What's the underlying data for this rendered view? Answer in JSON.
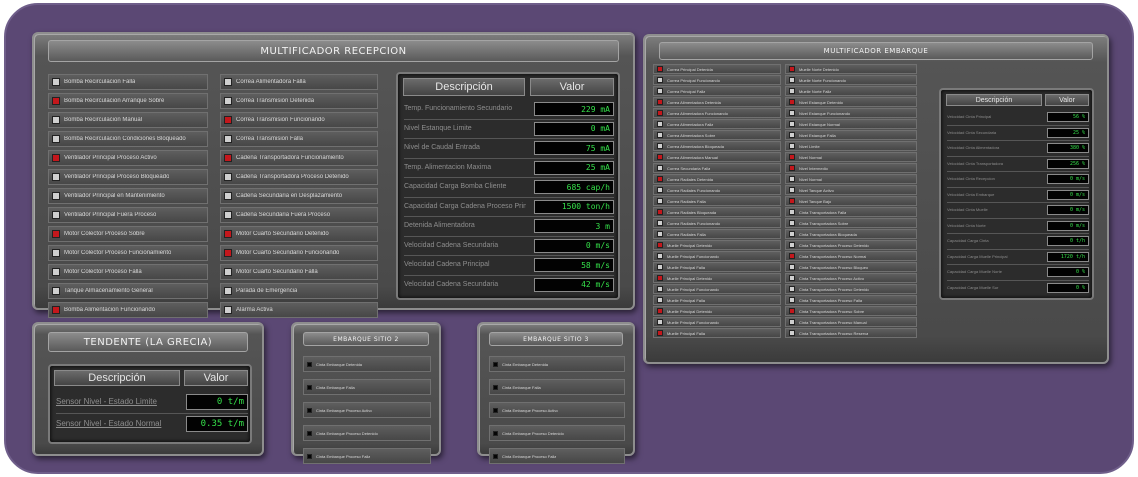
{
  "recepcion": {
    "title": "MULTIFICADOR RECEPCION",
    "col1": [
      {
        "label": "Bomba Recirculacion Falla",
        "color": "gray"
      },
      {
        "label": "Bomba Recirculacion Arranque Sobre",
        "color": "red"
      },
      {
        "label": "Bomba Recirculacion Manual",
        "color": "gray"
      },
      {
        "label": "Bomba Recirculacion Condiciones Bloqueado",
        "color": "gray"
      },
      {
        "label": "Ventilador Principal Proceso Activo",
        "color": "red"
      },
      {
        "label": "Ventilador Principal Proceso Bloqueado",
        "color": "gray"
      },
      {
        "label": "Ventilador Principal en Mantenimiento",
        "color": "gray"
      },
      {
        "label": "Ventilador Principal Fuera Proceso",
        "color": "gray"
      },
      {
        "label": "Motor Colector Proceso Sobre",
        "color": "red"
      },
      {
        "label": "Motor Colector Proceso Funcionamiento",
        "color": "gray"
      },
      {
        "label": "Motor Colector Proceso Falla",
        "color": "gray"
      },
      {
        "label": "Tanque Almacenamiento General",
        "color": "gray"
      },
      {
        "label": "Bomba Alimentacion Funcionando",
        "color": "red"
      }
    ],
    "col2": [
      {
        "label": "Correa Alimentadora Falla",
        "color": "gray"
      },
      {
        "label": "Correa Transmision Detenida",
        "color": "gray"
      },
      {
        "label": "Correa Transmision Funcionando",
        "color": "red"
      },
      {
        "label": "Correa Transmision Falla",
        "color": "gray"
      },
      {
        "label": "Cadena Transportadora Funcionamiento",
        "color": "red"
      },
      {
        "label": "Cadena Transportadora Proceso Detenido",
        "color": "gray"
      },
      {
        "label": "Cadena Secundaria en Desplazamiento",
        "color": "gray"
      },
      {
        "label": "Cadena Secundaria Fuera Proceso",
        "color": "gray"
      },
      {
        "label": "Motor Cuarto Secundario Detenido",
        "color": "red"
      },
      {
        "label": "Motor Cuarto Secundario Funcionando",
        "color": "red"
      },
      {
        "label": "Motor Cuarto Secundario Falla",
        "color": "gray"
      },
      {
        "label": "Parada de Emergencia",
        "color": "gray"
      },
      {
        "label": "Alarma Activa",
        "color": "gray"
      }
    ],
    "table": {
      "header_desc": "Descripción",
      "header_val": "Valor",
      "rows": [
        {
          "desc": "Temp. Funcionamiento Secundario",
          "value": "229  mA"
        },
        {
          "desc": "Nivel Estanque Limite",
          "value": "0  mA"
        },
        {
          "desc": "Nivel de Caudal Entrada",
          "value": "75  mA"
        },
        {
          "desc": "Temp. Alimentacion Maxima",
          "value": "25  mA"
        },
        {
          "desc": "Capacidad Carga Bomba Cliente",
          "value": "685 cap/h"
        },
        {
          "desc": "Capacidad Carga Cadena Proceso Principal",
          "value": "1500 ton/h"
        },
        {
          "desc": "Detenida Alimentadora",
          "value": "3  m"
        },
        {
          "desc": "Velocidad Cadena Secundaria",
          "value": "0  m/s"
        },
        {
          "desc": "Velocidad Cadena Principal",
          "value": "58  m/s"
        },
        {
          "desc": "Velocidad Cadena Secundaria",
          "value": "42  m/s"
        }
      ]
    }
  },
  "embarque": {
    "title": "MULTIFICADOR EMBARQUE",
    "col1": [
      {
        "label": "Correa Principal Detenida",
        "color": "red"
      },
      {
        "label": "Correa Principal Funcionando",
        "color": "gray"
      },
      {
        "label": "Correa Principal Falla",
        "color": "gray"
      },
      {
        "label": "Correa Alimentadora Detenida",
        "color": "red"
      },
      {
        "label": "Correa Alimentadora Funcionando",
        "color": "red"
      },
      {
        "label": "Correa Alimentadora Falla",
        "color": "gray"
      },
      {
        "label": "Correa Alimentadora Sobre",
        "color": "gray"
      },
      {
        "label": "Correa Alimentadora Bloqueada",
        "color": "gray"
      },
      {
        "label": "Correa Alimentadora Manual",
        "color": "red"
      },
      {
        "label": "Correa Secundaria Falla",
        "color": "gray"
      },
      {
        "label": "Correa Radiales Detenida",
        "color": "red"
      },
      {
        "label": "Correa Radiales Funcionando",
        "color": "gray"
      },
      {
        "label": "Correa Radiales Falla",
        "color": "gray"
      },
      {
        "label": "Correa Radiales Bloqueada",
        "color": "red"
      },
      {
        "label": "Correa Radiales Funcionando",
        "color": "gray"
      },
      {
        "label": "Correa Radiales Falla",
        "color": "gray"
      },
      {
        "label": "Muelle Principal Detenido",
        "color": "red"
      },
      {
        "label": "Muelle Principal Funcionando",
        "color": "gray"
      },
      {
        "label": "Muelle Principal Falla",
        "color": "gray"
      },
      {
        "label": "Muelle Principal Detenido",
        "color": "red"
      },
      {
        "label": "Muelle Principal Funcionando",
        "color": "gray"
      },
      {
        "label": "Muelle Principal Falla",
        "color": "gray"
      },
      {
        "label": "Muelle Principal Detenido",
        "color": "red"
      },
      {
        "label": "Muelle Principal Funcionando",
        "color": "gray"
      },
      {
        "label": "Muelle Principal Falla",
        "color": "red"
      }
    ],
    "col2": [
      {
        "label": "Muelle Norte Detenido",
        "color": "red"
      },
      {
        "label": "Muelle Norte Funcionando",
        "color": "gray"
      },
      {
        "label": "Muelle Norte Falla",
        "color": "gray"
      },
      {
        "label": "Nivel Estanque Detenido",
        "color": "red"
      },
      {
        "label": "Nivel Estanque Funcionando",
        "color": "gray"
      },
      {
        "label": "Nivel Estanque Normal",
        "color": "gray"
      },
      {
        "label": "Nivel Estanque Falla",
        "color": "gray"
      },
      {
        "label": "Nivel Limite",
        "color": "gray"
      },
      {
        "label": "Nivel Normal",
        "color": "red"
      },
      {
        "label": "Nivel Intermedio",
        "color": "red"
      },
      {
        "label": "Nivel Normal",
        "color": "gray"
      },
      {
        "label": "Nivel Tanque Activo",
        "color": "gray"
      },
      {
        "label": "Nivel Tanque Bajo",
        "color": "red"
      },
      {
        "label": "Cinta Transportadora Falla",
        "color": "gray"
      },
      {
        "label": "Cinta Transportadora Sobre",
        "color": "gray"
      },
      {
        "label": "Cinta Transportadora Bloqueada",
        "color": "gray"
      },
      {
        "label": "Cinta Transportadora Proceso Detenido",
        "color": "gray"
      },
      {
        "label": "Cinta Transportadora Proceso Normal",
        "color": "red"
      },
      {
        "label": "Cinta Transportadora Proceso Bloqueo",
        "color": "gray"
      },
      {
        "label": "Cinta Transportadora Proceso Activo",
        "color": "gray"
      },
      {
        "label": "Cinta Transportadora Proceso Detenido",
        "color": "gray"
      },
      {
        "label": "Cinta Transportadora Proceso Falla",
        "color": "gray"
      },
      {
        "label": "Cinta Transportadora Proceso Sobre",
        "color": "red"
      },
      {
        "label": "Cinta Transportadora Proceso Manual",
        "color": "gray"
      },
      {
        "label": "Cinta Transportadora Proceso Reserva",
        "color": "gray"
      }
    ],
    "table": {
      "header_desc": "Descripción",
      "header_val": "Valor",
      "rows": [
        {
          "desc": "Velocidad Cinta Principal",
          "value": "56  %"
        },
        {
          "desc": "Velocidad Cinta Secundaria",
          "value": "25  %"
        },
        {
          "desc": "Velocidad Cinta Alimentadora",
          "value": "380  %"
        },
        {
          "desc": "Velocidad Cinta Transportadora",
          "value": "256  %"
        },
        {
          "desc": "Velocidad Cinta Recepcion",
          "value": "0  m/s"
        },
        {
          "desc": "Velocidad Cinta Embarque",
          "value": "0  m/s"
        },
        {
          "desc": "Velocidad Cinta Muelle",
          "value": "0  m/s"
        },
        {
          "desc": "Velocidad Cinta Norte",
          "value": "0  m/s"
        },
        {
          "desc": "Capacidad Carga Cinta",
          "value": "0 t/h"
        },
        {
          "desc": "Capacidad Carga Muelle Principal",
          "value": "1720 t/h"
        },
        {
          "desc": "Capacidad Carga Muelle Norte",
          "value": "0  %"
        },
        {
          "desc": "Capacidad Carga Muelle Sur",
          "value": "0  %"
        }
      ]
    }
  },
  "tendente": {
    "title": "TENDENTE (LA GRECIA)",
    "header_desc": "Descripción",
    "header_val": "Valor",
    "rows": [
      {
        "desc": "Sensor Nivel - Estado Limite",
        "value": "0  t/m"
      },
      {
        "desc": "Sensor Nivel - Estado Normal",
        "value": "0.35  t/m"
      }
    ]
  },
  "embarque_2": {
    "title": "EMBARQUE SITIO 2",
    "items": [
      {
        "label": "Cinta Embarque Detenida",
        "color": "black"
      },
      {
        "label": "Cinta Embarque Falla",
        "color": "black"
      },
      {
        "label": "Cinta Embarque Proceso Activo",
        "color": "black"
      },
      {
        "label": "Cinta Embarque Proceso Detenido",
        "color": "black"
      },
      {
        "label": "Cinta Embarque Proceso Falla",
        "color": "black"
      }
    ]
  },
  "embarque_3": {
    "title": "EMBARQUE SITIO 3",
    "items": [
      {
        "label": "Cinta Embarque Detenida",
        "color": "black"
      },
      {
        "label": "Cinta Embarque Falla",
        "color": "black"
      },
      {
        "label": "Cinta Embarque Proceso Activo",
        "color": "black"
      },
      {
        "label": "Cinta Embarque Proceso Detenido",
        "color": "black"
      },
      {
        "label": "Cinta Embarque Proceso Falla",
        "color": "black"
      }
    ]
  }
}
